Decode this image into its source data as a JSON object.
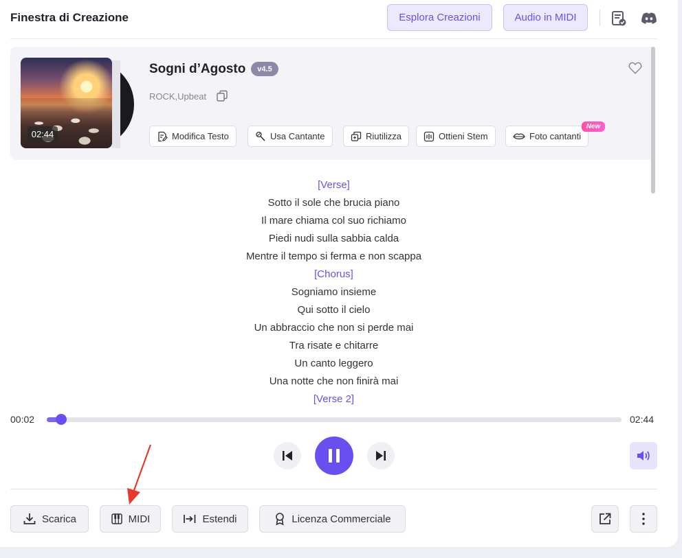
{
  "header": {
    "title": "Finestra di Creazione",
    "explore_label": "Esplora Creazioni",
    "audio_midi_label": "Audio in MIDI",
    "icons": [
      "list-check-icon",
      "discord-icon"
    ]
  },
  "song": {
    "title": "Sogni d’Agosto",
    "version": "v4.5",
    "tags": "ROCK,Upbeat",
    "duration": "02:44"
  },
  "actions": [
    {
      "label": "Modifica Testo",
      "icon": "edit-doc-icon"
    },
    {
      "label": "Usa Cantante",
      "icon": "microphone-icon"
    },
    {
      "label": "Riutilizza",
      "icon": "reuse-icon"
    },
    {
      "label": "Ottieni Stem",
      "icon": "waveform-icon"
    },
    {
      "label": "Foto cantanti",
      "icon": "lips-icon"
    }
  ],
  "new_badge": "New",
  "lyrics": [
    {
      "text": "[Verse]",
      "section": true
    },
    {
      "text": "Sotto il sole che brucia piano",
      "section": false
    },
    {
      "text": "Il mare chiama col suo richiamo",
      "section": false
    },
    {
      "text": "Piedi nudi sulla sabbia calda",
      "section": false
    },
    {
      "text": "Mentre il tempo si ferma e non scappa",
      "section": false
    },
    {
      "text": "[Chorus]",
      "section": true
    },
    {
      "text": "Sogniamo insieme",
      "section": false
    },
    {
      "text": "Qui sotto il cielo",
      "section": false
    },
    {
      "text": "Un abbraccio che non si perde mai",
      "section": false
    },
    {
      "text": "Tra risate e chitarre",
      "section": false
    },
    {
      "text": "Un canto leggero",
      "section": false
    },
    {
      "text": "Una notte che non finirà mai",
      "section": false
    },
    {
      "text": "[Verse 2]",
      "section": true
    }
  ],
  "player": {
    "current_time": "00:02",
    "total_time": "02:44",
    "progress": 0.018,
    "state": "playing"
  },
  "bottom": {
    "download_label": "Scarica",
    "midi_label": "MIDI",
    "extend_label": "Estendi",
    "license_label": "Licenza Commerciale"
  },
  "colors": {
    "accent": "#6a4ff0",
    "accent_light": "#ece9fd",
    "new_badge": "#ff4fa3",
    "annotation_arrow": "#e8392a"
  }
}
